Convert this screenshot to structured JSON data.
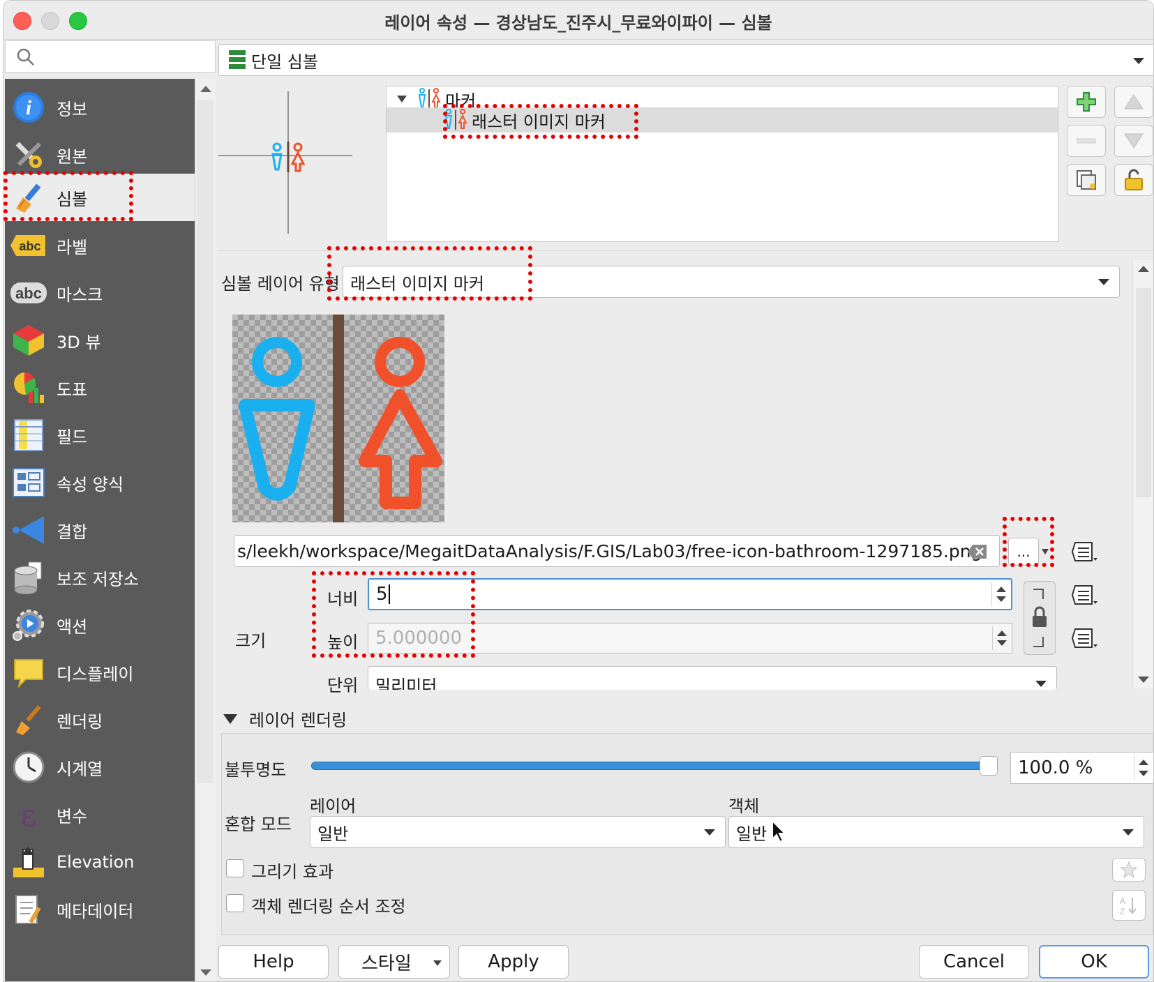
{
  "window": {
    "title": "레이어 속성 — 경상남도_진주시_무료와이파이 — 심볼"
  },
  "search": {
    "placeholder": ""
  },
  "sidebar": {
    "items": [
      {
        "label": "정보",
        "icon": "info-icon"
      },
      {
        "label": "원본",
        "icon": "tools-icon"
      },
      {
        "label": "심볼",
        "icon": "paintbrush-icon",
        "selected": true
      },
      {
        "label": "라벨",
        "icon": "label-abc-icon"
      },
      {
        "label": "마스크",
        "icon": "mask-abc-icon"
      },
      {
        "label": "3D 뷰",
        "icon": "cube-icon"
      },
      {
        "label": "도표",
        "icon": "diagram-icon"
      },
      {
        "label": "필드",
        "icon": "fields-icon"
      },
      {
        "label": "속성 양식",
        "icon": "form-icon"
      },
      {
        "label": "결합",
        "icon": "join-icon"
      },
      {
        "label": "보조 저장소",
        "icon": "database-icon"
      },
      {
        "label": "액션",
        "icon": "action-gear-icon"
      },
      {
        "label": "디스플레이",
        "icon": "speech-bubble-icon"
      },
      {
        "label": "렌더링",
        "icon": "brush-icon"
      },
      {
        "label": "시계열",
        "icon": "clock-icon"
      },
      {
        "label": "변수",
        "icon": "epsilon-icon"
      },
      {
        "label": "Elevation",
        "icon": "elevation-icon"
      },
      {
        "label": "메타데이터",
        "icon": "metadata-icon"
      }
    ]
  },
  "renderer": {
    "type": "단일 심볼"
  },
  "symbol_tree": {
    "parent": "마커",
    "child": "래스터 이미지 마커"
  },
  "symbol_layer": {
    "type_label": "심볼 레이어 유형",
    "type_value": "래스터 이미지 마커",
    "file_path": "s/leekh/workspace/MegaitDataAnalysis/F.GIS/Lab03/free-icon-bathroom-1297185.png",
    "browse_label": "...",
    "size_label": "크기",
    "width_label": "너비",
    "width_value": "5",
    "height_label": "높이",
    "height_value": "5.000000",
    "unit_label": "단위",
    "unit_value": "밀리미터"
  },
  "layer_rendering": {
    "header": "레이어 렌더링",
    "opacity_label": "불투명도",
    "opacity_value": "100.0 %",
    "opacity_fraction": 1.0,
    "blend_label": "혼합 모드",
    "blend_layer_label": "레이어",
    "blend_layer_value": "일반",
    "blend_feature_label": "객체",
    "blend_feature_value": "일반",
    "draw_effects_label": "그리기 효과",
    "feature_order_label": "객체 렌더링 순서 조정"
  },
  "buttons": {
    "help": "Help",
    "style": "스타일",
    "apply": "Apply",
    "cancel": "Cancel",
    "ok": "OK"
  },
  "colors": {
    "sidebar_bg": "#5a5a5a",
    "highlight_red": "#e60000",
    "male_blue": "#1ab0f0",
    "female_red": "#f0502a",
    "slider_blue": "#3a8fd9"
  }
}
